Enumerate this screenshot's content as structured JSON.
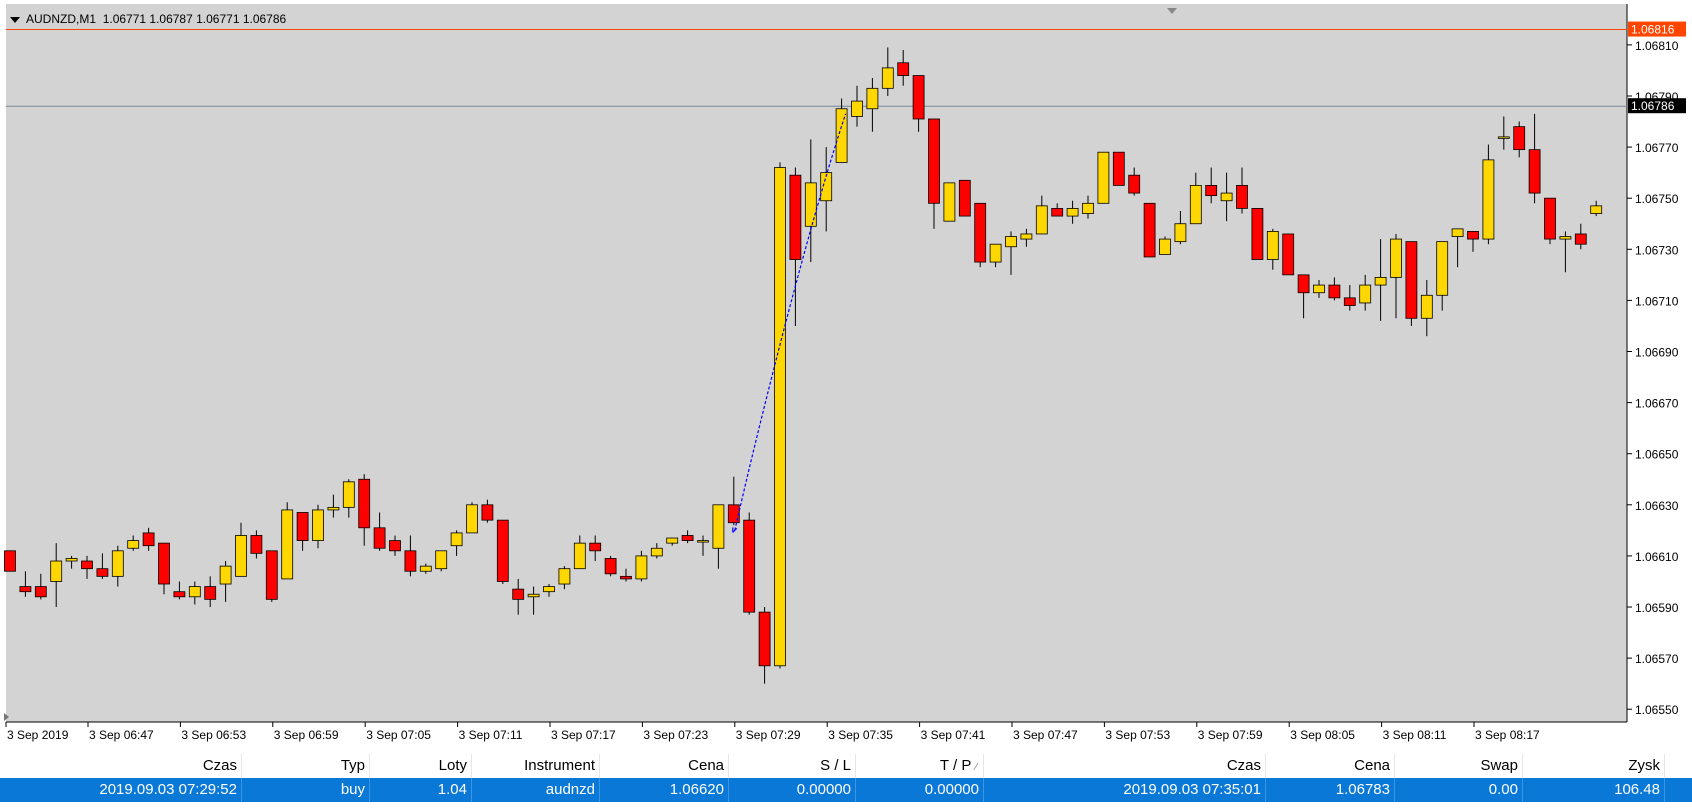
{
  "header": {
    "symbol": "AUDNZD,M1",
    "ohlc": "1.06771 1.06787 1.06771 1.06786"
  },
  "colors": {
    "background": "#d3d3d3",
    "bull": "#ffd700",
    "bear": "#ff0000",
    "wick": "#000000",
    "ask_line": "#ff4500",
    "bid_line": "#778899",
    "trade_line": "#0000ff",
    "selected_row": "#0a78d7"
  },
  "chart_data": {
    "type": "candlestick",
    "title": "AUDNZD,M1",
    "ylim": [
      1.06545,
      1.06826
    ],
    "y_ticks": [
      "1.06810",
      "1.06790",
      "1.06770",
      "1.06750",
      "1.06730",
      "1.06710",
      "1.06690",
      "1.06670",
      "1.06650",
      "1.06630",
      "1.06610",
      "1.06590",
      "1.06570",
      "1.06550"
    ],
    "x_tick_labels": [
      "3 Sep 2019",
      "3 Sep 06:47",
      "3 Sep 06:53",
      "3 Sep 06:59",
      "3 Sep 07:05",
      "3 Sep 07:11",
      "3 Sep 07:17",
      "3 Sep 07:23",
      "3 Sep 07:29",
      "3 Sep 07:35",
      "3 Sep 07:41",
      "3 Sep 07:47",
      "3 Sep 07:53",
      "3 Sep 07:59",
      "3 Sep 08:05",
      "3 Sep 08:11",
      "3 Sep 08:17"
    ],
    "ask_price": "1.06816",
    "bid_price": "1.06786",
    "ohlc": [
      [
        1.06612,
        1.06612,
        1.06604,
        1.06604
      ],
      [
        1.06598,
        1.06604,
        1.06594,
        1.06596
      ],
      [
        1.06598,
        1.06603,
        1.06593,
        1.06594
      ],
      [
        1.066,
        1.06615,
        1.0659,
        1.06608
      ],
      [
        1.06608,
        1.0661,
        1.06605,
        1.06609
      ],
      [
        1.06608,
        1.0661,
        1.06601,
        1.06605
      ],
      [
        1.06605,
        1.06611,
        1.06601,
        1.06602
      ],
      [
        1.06602,
        1.06614,
        1.06598,
        1.06612
      ],
      [
        1.06613,
        1.06618,
        1.06612,
        1.06616
      ],
      [
        1.06619,
        1.06621,
        1.06612,
        1.06614
      ],
      [
        1.06615,
        1.06615,
        1.06595,
        1.06599
      ],
      [
        1.06596,
        1.066,
        1.06593,
        1.06594
      ],
      [
        1.06594,
        1.066,
        1.06591,
        1.06598
      ],
      [
        1.06598,
        1.06602,
        1.0659,
        1.06593
      ],
      [
        1.06599,
        1.06608,
        1.06592,
        1.06606
      ],
      [
        1.06602,
        1.06623,
        1.06602,
        1.06618
      ],
      [
        1.06618,
        1.0662,
        1.06609,
        1.06611
      ],
      [
        1.06612,
        1.06612,
        1.06592,
        1.06593
      ],
      [
        1.06601,
        1.06631,
        1.06601,
        1.06628
      ],
      [
        1.06627,
        1.06627,
        1.06612,
        1.06616
      ],
      [
        1.06616,
        1.0663,
        1.06613,
        1.06628
      ],
      [
        1.06628,
        1.06634,
        1.06625,
        1.06629
      ],
      [
        1.06629,
        1.0664,
        1.06625,
        1.06639
      ],
      [
        1.0664,
        1.06642,
        1.06614,
        1.06621
      ],
      [
        1.06621,
        1.06627,
        1.06612,
        1.06613
      ],
      [
        1.06616,
        1.06618,
        1.0661,
        1.06612
      ],
      [
        1.06612,
        1.06618,
        1.06602,
        1.06604
      ],
      [
        1.06604,
        1.06607,
        1.06603,
        1.06606
      ],
      [
        1.06605,
        1.06612,
        1.06604,
        1.06612
      ],
      [
        1.06614,
        1.0662,
        1.0661,
        1.06619
      ],
      [
        1.06619,
        1.06631,
        1.06619,
        1.0663
      ],
      [
        1.0663,
        1.06632,
        1.06623,
        1.06624
      ],
      [
        1.06624,
        1.06624,
        1.06599,
        1.066
      ],
      [
        1.06597,
        1.06601,
        1.06587,
        1.06593
      ],
      [
        1.06594,
        1.06598,
        1.06587,
        1.06595
      ],
      [
        1.06596,
        1.06599,
        1.06594,
        1.06598
      ],
      [
        1.06599,
        1.06606,
        1.06597,
        1.06605
      ],
      [
        1.06605,
        1.06618,
        1.06605,
        1.06615
      ],
      [
        1.06615,
        1.06618,
        1.06608,
        1.06612
      ],
      [
        1.06609,
        1.0661,
        1.06602,
        1.06603
      ],
      [
        1.06602,
        1.06605,
        1.066,
        1.06601
      ],
      [
        1.06601,
        1.06612,
        1.066,
        1.0661
      ],
      [
        1.0661,
        1.06615,
        1.06609,
        1.06613
      ],
      [
        1.06615,
        1.06617,
        1.06614,
        1.06617
      ],
      [
        1.06618,
        1.0662,
        1.06615,
        1.06616
      ],
      [
        1.06616,
        1.06618,
        1.0661,
        1.06616
      ],
      [
        1.06613,
        1.0663,
        1.06605,
        1.0663
      ],
      [
        1.0663,
        1.06641,
        1.06622,
        1.06623
      ],
      [
        1.06624,
        1.06627,
        1.06587,
        1.06588
      ],
      [
        1.06588,
        1.0659,
        1.0656,
        1.06567
      ],
      [
        1.06567,
        1.06764,
        1.06566,
        1.06762
      ],
      [
        1.06759,
        1.06762,
        1.067,
        1.06726
      ],
      [
        1.06739,
        1.06773,
        1.06725,
        1.06756
      ],
      [
        1.06749,
        1.0677,
        1.06737,
        1.0676
      ],
      [
        1.06764,
        1.06789,
        1.06764,
        1.06785
      ],
      [
        1.06782,
        1.06794,
        1.06778,
        1.06788
      ],
      [
        1.06785,
        1.06797,
        1.06776,
        1.06793
      ],
      [
        1.06793,
        1.06809,
        1.0679,
        1.06801
      ],
      [
        1.06803,
        1.06808,
        1.06794,
        1.06798
      ],
      [
        1.06798,
        1.06798,
        1.06776,
        1.06781
      ],
      [
        1.06781,
        1.06781,
        1.06738,
        1.06748
      ],
      [
        1.06741,
        1.06756,
        1.06741,
        1.06756
      ],
      [
        1.06757,
        1.06757,
        1.06743,
        1.06743
      ],
      [
        1.06748,
        1.06748,
        1.06723,
        1.06725
      ],
      [
        1.06725,
        1.06732,
        1.06723,
        1.06732
      ],
      [
        1.06731,
        1.06737,
        1.0672,
        1.06735
      ],
      [
        1.06734,
        1.06738,
        1.06731,
        1.06736
      ],
      [
        1.06736,
        1.06751,
        1.06736,
        1.06747
      ],
      [
        1.06746,
        1.06748,
        1.06743,
        1.06743
      ],
      [
        1.06743,
        1.06749,
        1.0674,
        1.06746
      ],
      [
        1.06744,
        1.06751,
        1.06742,
        1.06748
      ],
      [
        1.06748,
        1.06768,
        1.06748,
        1.06768
      ],
      [
        1.06768,
        1.06768,
        1.06755,
        1.06755
      ],
      [
        1.06759,
        1.06762,
        1.06751,
        1.06752
      ],
      [
        1.06748,
        1.06748,
        1.06727,
        1.06727
      ],
      [
        1.06728,
        1.06735,
        1.06728,
        1.06734
      ],
      [
        1.06733,
        1.06745,
        1.06732,
        1.0674
      ],
      [
        1.0674,
        1.0676,
        1.0674,
        1.06755
      ],
      [
        1.06755,
        1.06762,
        1.06748,
        1.06751
      ],
      [
        1.06749,
        1.0676,
        1.06741,
        1.06752
      ],
      [
        1.06755,
        1.06762,
        1.06744,
        1.06746
      ],
      [
        1.06746,
        1.06746,
        1.06726,
        1.06726
      ],
      [
        1.06726,
        1.06738,
        1.06722,
        1.06737
      ],
      [
        1.06736,
        1.06736,
        1.0672,
        1.0672
      ],
      [
        1.0672,
        1.0672,
        1.06703,
        1.06713
      ],
      [
        1.06713,
        1.06718,
        1.06711,
        1.06716
      ],
      [
        1.06716,
        1.06719,
        1.0671,
        1.06711
      ],
      [
        1.06711,
        1.06716,
        1.06706,
        1.06708
      ],
      [
        1.06709,
        1.0672,
        1.06706,
        1.06716
      ],
      [
        1.06716,
        1.06734,
        1.06702,
        1.06719
      ],
      [
        1.06719,
        1.06736,
        1.06703,
        1.06734
      ],
      [
        1.06733,
        1.06733,
        1.067,
        1.06703
      ],
      [
        1.06703,
        1.06718,
        1.06696,
        1.06712
      ],
      [
        1.06712,
        1.06733,
        1.06706,
        1.06733
      ],
      [
        1.06735,
        1.06738,
        1.06723,
        1.06738
      ],
      [
        1.06737,
        1.06737,
        1.06729,
        1.06734
      ],
      [
        1.06734,
        1.06771,
        1.06732,
        1.06765
      ],
      [
        1.06774,
        1.06782,
        1.06769,
        1.06774
      ],
      [
        1.06778,
        1.0678,
        1.06766,
        1.06769
      ],
      [
        1.06769,
        1.06783,
        1.06748,
        1.06752
      ],
      [
        1.0675,
        1.0675,
        1.06732,
        1.06734
      ],
      [
        1.06734,
        1.06737,
        1.06721,
        1.06735
      ],
      [
        1.06736,
        1.0674,
        1.0673,
        1.06732
      ],
      [
        1.06744,
        1.06749,
        1.06743,
        1.06747
      ]
    ],
    "trade": {
      "open_price": 1.0662,
      "close_price": 1.06783
    }
  },
  "terminal": {
    "columns": {
      "time_open": "Czas",
      "type": "Typ",
      "lots": "Loty",
      "instrument": "Instrument",
      "price_open": "Cena",
      "sl": "S / L",
      "tp": "T / P",
      "tp_mark": "⁄",
      "time_close": "Czas",
      "price_close": "Cena",
      "swap": "Swap",
      "profit": "Zysk"
    },
    "row": {
      "time_open": "2019.09.03 07:29:52",
      "type": "buy",
      "lots": "1.04",
      "instrument": "audnzd",
      "price_open": "1.06620",
      "sl": "0.00000",
      "tp": "0.00000",
      "time_close": "2019.09.03 07:35:01",
      "price_close": "1.06783",
      "swap": "0.00",
      "profit": "106.48"
    }
  }
}
